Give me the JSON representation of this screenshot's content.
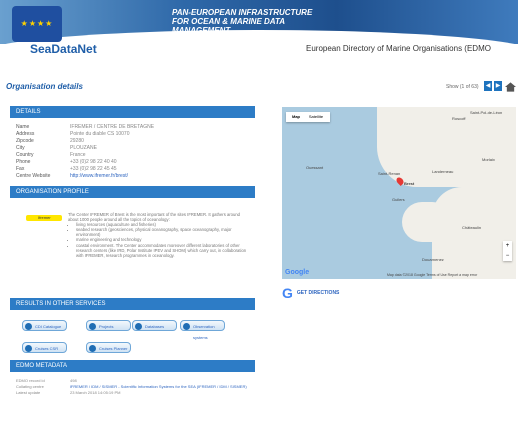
{
  "header": {
    "banner_lines": [
      "PAN-EUROPEAN INFRASTRUCTURE",
      "FOR OCEAN & MARINE DATA",
      "MANAGEMENT"
    ],
    "logo": "SeaDataNet",
    "directory_title": "European Directory of Marine Organisations (EDMO"
  },
  "page": {
    "title": "Organisation details",
    "show_text": "Show (1 of 63)"
  },
  "details": {
    "heading": "DETAILS",
    "rows": [
      {
        "k": "Name",
        "v": "IFREMER / CENTRE DE BRETAGNE"
      },
      {
        "k": "Address",
        "v": "Pointe du diable CS 10070"
      },
      {
        "k": "Zipcode",
        "v": "29280"
      },
      {
        "k": "City",
        "v": "PLOUZANE"
      },
      {
        "k": "Country",
        "v": "France"
      },
      {
        "k": "Phone",
        "v": "+33 (0)2 98 22 40 40"
      },
      {
        "k": "Fax",
        "v": "+33 (0)2 98 22 45 45"
      },
      {
        "k": "Centre Website",
        "v": "http://www.ifremer.fr/brest/"
      }
    ]
  },
  "profile": {
    "heading": "ORGANISATION PROFILE",
    "highlight_label": "Ifremer",
    "intro": "The Center IFREMER of Brest is the most important of the sites IFREMER. It gathers around about 1000 people around all the topics of oceanology:",
    "bullets": [
      "living resources (aquaculture and fisheries)",
      "seabed research (geosciences, physical oceanography, space oceanography, major environment)",
      "marine engineering and technology",
      "coastal environment. The Center accommodates moreover different laboratories of other research centers (like IRD, Polar Institute IPEV and SHOM) which carry out, in collaboration with IFREMER, research programmes in oceanology."
    ]
  },
  "services": {
    "heading": "RESULTS IN OTHER SERVICES",
    "buttons": [
      "CDI Catalogue",
      "Projects",
      "Databases",
      "Observation systems",
      "Cruises CSR",
      "Cruises Planner"
    ]
  },
  "edmo": {
    "heading": "EDMO METADATA",
    "rows": [
      {
        "k": "EDMO record id",
        "v": "498"
      },
      {
        "k": "Collating centre",
        "v": "IFREMER / IDM / SISMER - Scientific Information Systems for the SEA (IFREMER / IDM / SISMER)"
      },
      {
        "k": "Latest update",
        "v": "23 March 2018 14:05:19 PM"
      }
    ]
  },
  "map": {
    "type_map": "Map",
    "type_sat": "Satellite",
    "labels": [
      "Saint-Pol-de-Léon",
      "Roscoff",
      "Ouessant",
      "Saint-Renan",
      "Landerneau",
      "Brest",
      "Morlaix",
      "Châteaulin",
      "Douarnenez",
      "Guilers"
    ],
    "google": "Google",
    "footer": "Map data ©2018 Google  Terms of Use  Report a map error"
  },
  "directions": {
    "label": "GET DIRECTIONS"
  }
}
